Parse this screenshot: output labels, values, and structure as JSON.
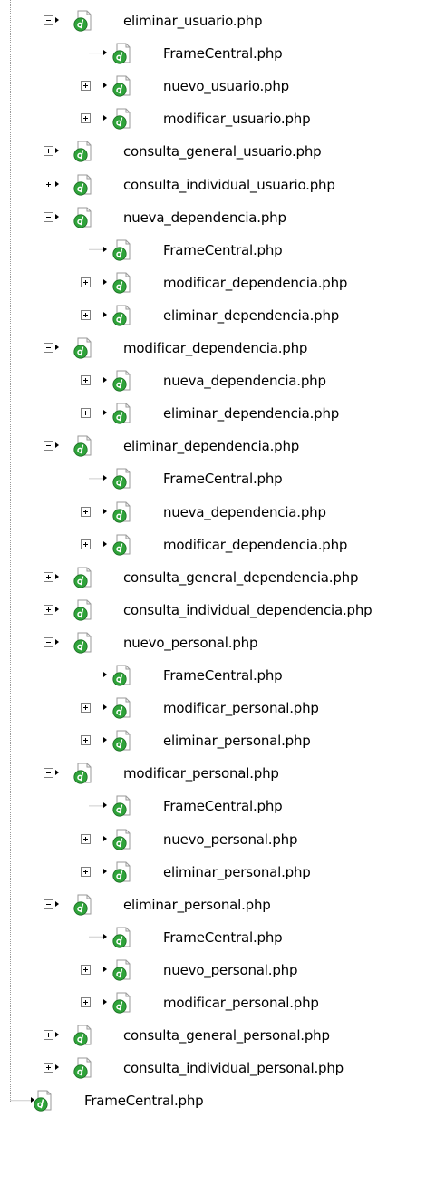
{
  "tree": {
    "items": [
      {
        "level": 1,
        "expander": "minus",
        "label": "eliminar_usuario.php"
      },
      {
        "level": 2,
        "expander": "none",
        "label": "FrameCentral.php"
      },
      {
        "level": 2,
        "expander": "plus",
        "label": "nuevo_usuario.php"
      },
      {
        "level": 2,
        "expander": "plus",
        "label": "modificar_usuario.php"
      },
      {
        "level": 1,
        "expander": "plus",
        "label": "consulta_general_usuario.php"
      },
      {
        "level": 1,
        "expander": "plus",
        "label": "consulta_individual_usuario.php"
      },
      {
        "level": 1,
        "expander": "minus",
        "label": "nueva_dependencia.php"
      },
      {
        "level": 2,
        "expander": "none",
        "label": "FrameCentral.php"
      },
      {
        "level": 2,
        "expander": "plus",
        "label": "modificar_dependencia.php"
      },
      {
        "level": 2,
        "expander": "plus",
        "label": "eliminar_dependencia.php"
      },
      {
        "level": 1,
        "expander": "minus",
        "label": "modificar_dependencia.php"
      },
      {
        "level": 2,
        "expander": "plus",
        "label": "nueva_dependencia.php"
      },
      {
        "level": 2,
        "expander": "plus",
        "label": "eliminar_dependencia.php"
      },
      {
        "level": 1,
        "expander": "minus",
        "label": "eliminar_dependencia.php"
      },
      {
        "level": 2,
        "expander": "none",
        "label": "FrameCentral.php"
      },
      {
        "level": 2,
        "expander": "plus",
        "label": "nueva_dependencia.php"
      },
      {
        "level": 2,
        "expander": "plus",
        "label": "modificar_dependencia.php"
      },
      {
        "level": 1,
        "expander": "plus",
        "label": "consulta_general_dependencia.php"
      },
      {
        "level": 1,
        "expander": "plus",
        "label": "consulta_individual_dependencia.php"
      },
      {
        "level": 1,
        "expander": "minus",
        "label": "nuevo_personal.php"
      },
      {
        "level": 2,
        "expander": "none",
        "label": "FrameCentral.php"
      },
      {
        "level": 2,
        "expander": "plus",
        "label": "modificar_personal.php"
      },
      {
        "level": 2,
        "expander": "plus",
        "label": "eliminar_personal.php"
      },
      {
        "level": 1,
        "expander": "minus",
        "label": "modificar_personal.php"
      },
      {
        "level": 2,
        "expander": "none",
        "label": "FrameCentral.php"
      },
      {
        "level": 2,
        "expander": "plus",
        "label": "nuevo_personal.php"
      },
      {
        "level": 2,
        "expander": "plus",
        "label": "eliminar_personal.php"
      },
      {
        "level": 1,
        "expander": "minus",
        "label": "eliminar_personal.php"
      },
      {
        "level": 2,
        "expander": "none",
        "label": "FrameCentral.php"
      },
      {
        "level": 2,
        "expander": "plus",
        "label": "nuevo_personal.php"
      },
      {
        "level": 2,
        "expander": "plus",
        "label": "modificar_personal.php"
      },
      {
        "level": 1,
        "expander": "plus",
        "label": "consulta_general_personal.php"
      },
      {
        "level": 1,
        "expander": "plus",
        "label": "consulta_individual_personal.php"
      },
      {
        "level": 0,
        "expander": "none",
        "label": "FrameCentral.php"
      }
    ]
  },
  "icon": {
    "name": "php-file-icon",
    "page_color": "#ffffff",
    "page_border": "#9a9a9a",
    "badge_color": "#2fa33a",
    "badge_dark": "#1a6e22"
  },
  "colors": {
    "connector": "#9a9a9a",
    "text": "#000000"
  }
}
